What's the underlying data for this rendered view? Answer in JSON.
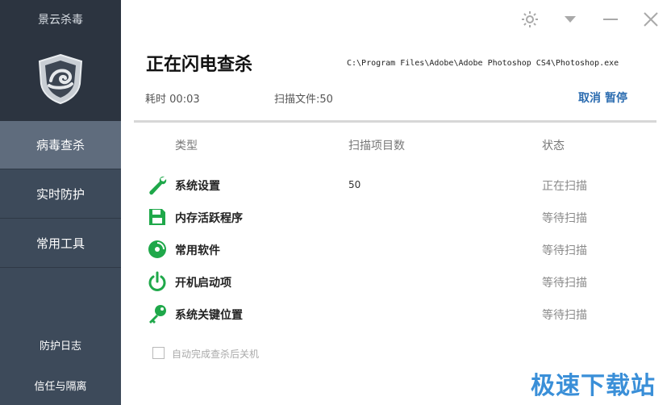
{
  "app": {
    "title": "景云杀毒",
    "accent_color": "#2b6cb0",
    "icon_green": "#1fa84a"
  },
  "sidebar": {
    "logo_icon": "shield-icon",
    "items": [
      {
        "label": "病毒查杀",
        "active": true
      },
      {
        "label": "实时防护",
        "active": false
      },
      {
        "label": "常用工具",
        "active": false
      }
    ],
    "bottom_links": [
      {
        "label": "防护日志"
      },
      {
        "label": "信任与隔离"
      }
    ]
  },
  "window_controls": [
    "gear-icon",
    "dropdown-icon",
    "minimize-icon",
    "close-icon"
  ],
  "scan": {
    "title": "正在闪电查杀",
    "current_file": "C:\\Program Files\\Adobe\\Adobe Photoshop CS4\\Photoshop.exe",
    "elapsed_label": "耗时",
    "elapsed_value": "00:03",
    "files_label": "扫描文件:",
    "files_value": "50",
    "cancel_label": "取消",
    "pause_label": "暂停"
  },
  "table": {
    "headers": {
      "type": "类型",
      "count": "扫描项目数",
      "status": "状态"
    },
    "rows": [
      {
        "icon": "wrench-icon",
        "label": "系统设置",
        "count": "50",
        "status": "正在扫描"
      },
      {
        "icon": "floppy-disk-icon",
        "label": "内存活跃程序",
        "count": "",
        "status": "等待扫描"
      },
      {
        "icon": "disc-icon",
        "label": "常用软件",
        "count": "",
        "status": "等待扫描"
      },
      {
        "icon": "power-icon",
        "label": "开机启动项",
        "count": "",
        "status": "等待扫描"
      },
      {
        "icon": "key-icon",
        "label": "系统关键位置",
        "count": "",
        "status": "等待扫描"
      }
    ]
  },
  "auto_shutdown": {
    "label": "自动完成查杀后关机",
    "checked": false
  },
  "watermark": "极速下载站"
}
